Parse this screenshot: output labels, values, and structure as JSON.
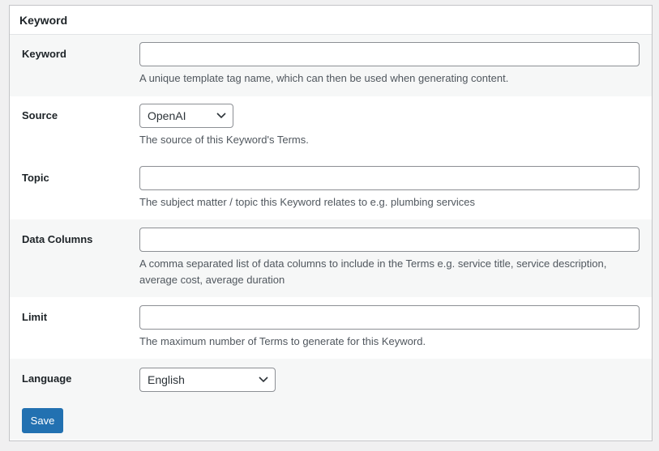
{
  "panel": {
    "title": "Keyword"
  },
  "fields": {
    "keyword": {
      "label": "Keyword",
      "value": "",
      "description": "A unique template tag name, which can then be used when generating content."
    },
    "source": {
      "label": "Source",
      "selected": "OpenAI",
      "description": "The source of this Keyword's Terms."
    },
    "topic": {
      "label": "Topic",
      "value": "",
      "description": "The subject matter / topic this Keyword relates to e.g. plumbing services"
    },
    "data_columns": {
      "label": "Data Columns",
      "value": "",
      "description": "A comma separated list of data columns to include in the Terms e.g. service title, service description, average cost, average duration"
    },
    "limit": {
      "label": "Limit",
      "value": "",
      "description": "The maximum number of Terms to generate for this Keyword."
    },
    "language": {
      "label": "Language",
      "selected": "English"
    }
  },
  "actions": {
    "save_label": "Save"
  },
  "colors": {
    "primary": "#2271b1",
    "border": "#8c8f94",
    "alt_row": "#f6f7f7",
    "page_bg": "#f0f0f1"
  },
  "icons": {
    "select_arrow": "chevron-down-icon"
  }
}
